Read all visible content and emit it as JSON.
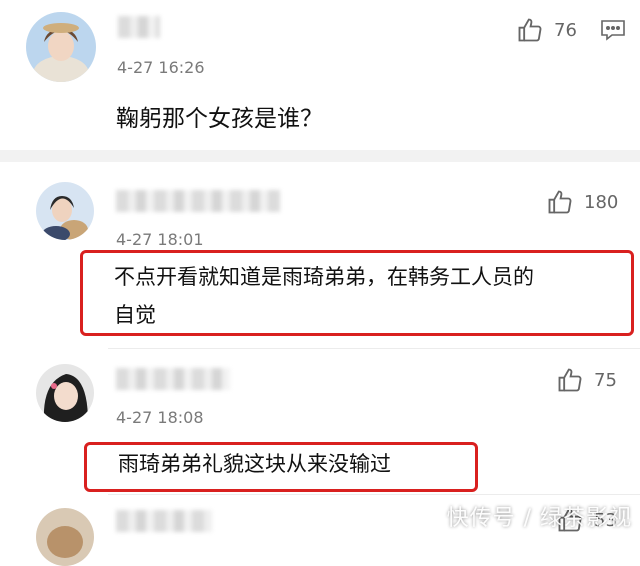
{
  "comments": [
    {
      "time": "4-27 16:26",
      "likes": "76",
      "text": "鞠躬那个女孩是谁？"
    },
    {
      "time": "4-27 18:01",
      "likes": "180",
      "text_line1": "不点开看就知道是雨琦弟弟，在韩务工人员的",
      "text_line2": "自觉"
    },
    {
      "time": "4-27 18:08",
      "likes": "75",
      "text": "雨琦弟弟礼貌这块从来没输过"
    },
    {
      "likes": "53"
    }
  ],
  "watermark": "快传号 / 绿茶影视",
  "colors": {
    "highlight": "#d9201f",
    "divider": "#f2f2f2"
  }
}
